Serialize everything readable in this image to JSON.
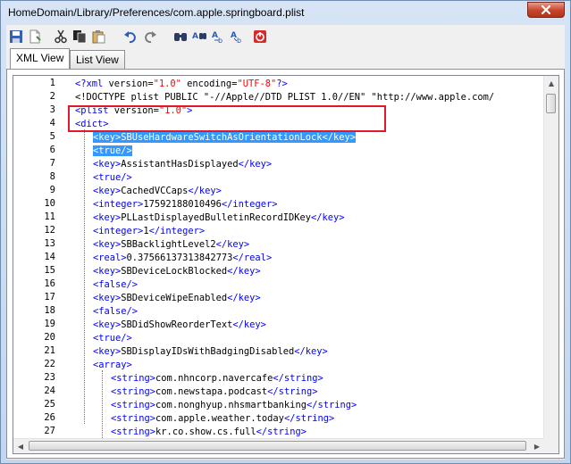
{
  "window": {
    "title": "HomeDomain/Library/Preferences/com.apple.springboard.plist"
  },
  "toolbar": {
    "buttons": [
      "save-icon",
      "new-icon",
      "cut-icon",
      "copy-icon",
      "paste-icon",
      "undo-icon",
      "redo-icon",
      "find-icon",
      "find-replace-icon",
      "find-next-icon",
      "replace-icon",
      "stop-icon"
    ]
  },
  "tabs": [
    {
      "label": "XML View",
      "active": true
    },
    {
      "label": "List View",
      "active": false
    }
  ],
  "line_numbers": [
    "1",
    "2",
    "3",
    "4",
    "5",
    "6",
    "7",
    "8",
    "9",
    "10",
    "11",
    "12",
    "13",
    "14",
    "15",
    "16",
    "17",
    "18",
    "19",
    "20",
    "21",
    "22",
    "23",
    "24",
    "25",
    "26",
    "27"
  ],
  "lines": [
    {
      "indent": 0,
      "segments": [
        [
          "tag",
          "<?xml "
        ],
        [
          "txt",
          "version="
        ],
        [
          "str",
          "\"1.0\""
        ],
        [
          "txt",
          " encoding="
        ],
        [
          "str",
          "\"UTF-8\""
        ],
        [
          "tag",
          "?>"
        ]
      ]
    },
    {
      "indent": 0,
      "segments": [
        [
          "txt",
          "<!DOCTYPE plist PUBLIC \"-//Apple//DTD PLIST 1.0//EN\" \"http://www.apple.com/"
        ]
      ]
    },
    {
      "indent": 0,
      "segments": [
        [
          "tag",
          "<plist "
        ],
        [
          "txt",
          "version="
        ],
        [
          "str",
          "\"1.0\""
        ],
        [
          "tag",
          ">"
        ]
      ]
    },
    {
      "indent": 0,
      "segments": [
        [
          "tag",
          "<dict>"
        ]
      ]
    },
    {
      "indent": 1,
      "selected": true,
      "segments": [
        [
          "sel",
          "<key>SBUseHardwareSwitchAsOrientationLock</key>"
        ]
      ]
    },
    {
      "indent": 1,
      "selected": true,
      "segments": [
        [
          "sel",
          "<true/>"
        ]
      ]
    },
    {
      "indent": 1,
      "segments": [
        [
          "tag",
          "<key>"
        ],
        [
          "txt",
          "AssistantHasDisplayed"
        ],
        [
          "tag",
          "</key>"
        ]
      ]
    },
    {
      "indent": 1,
      "segments": [
        [
          "tag",
          "<true/>"
        ]
      ]
    },
    {
      "indent": 1,
      "segments": [
        [
          "tag",
          "<key>"
        ],
        [
          "txt",
          "CachedVCCaps"
        ],
        [
          "tag",
          "</key>"
        ]
      ]
    },
    {
      "indent": 1,
      "segments": [
        [
          "tag",
          "<integer>"
        ],
        [
          "txt",
          "17592188010496"
        ],
        [
          "tag",
          "</integer>"
        ]
      ]
    },
    {
      "indent": 1,
      "segments": [
        [
          "tag",
          "<key>"
        ],
        [
          "txt",
          "PLLastDisplayedBulletinRecordIDKey"
        ],
        [
          "tag",
          "</key>"
        ]
      ]
    },
    {
      "indent": 1,
      "segments": [
        [
          "tag",
          "<integer>"
        ],
        [
          "txt",
          "1"
        ],
        [
          "tag",
          "</integer>"
        ]
      ]
    },
    {
      "indent": 1,
      "segments": [
        [
          "tag",
          "<key>"
        ],
        [
          "txt",
          "SBBacklightLevel2"
        ],
        [
          "tag",
          "</key>"
        ]
      ]
    },
    {
      "indent": 1,
      "segments": [
        [
          "tag",
          "<real>"
        ],
        [
          "txt",
          "0.37566137313842773"
        ],
        [
          "tag",
          "</real>"
        ]
      ]
    },
    {
      "indent": 1,
      "segments": [
        [
          "tag",
          "<key>"
        ],
        [
          "txt",
          "SBDeviceLockBlocked"
        ],
        [
          "tag",
          "</key>"
        ]
      ]
    },
    {
      "indent": 1,
      "segments": [
        [
          "tag",
          "<false/>"
        ]
      ]
    },
    {
      "indent": 1,
      "segments": [
        [
          "tag",
          "<key>"
        ],
        [
          "txt",
          "SBDeviceWipeEnabled"
        ],
        [
          "tag",
          "</key>"
        ]
      ]
    },
    {
      "indent": 1,
      "segments": [
        [
          "tag",
          "<false/>"
        ]
      ]
    },
    {
      "indent": 1,
      "segments": [
        [
          "tag",
          "<key>"
        ],
        [
          "txt",
          "SBDidShowReorderText"
        ],
        [
          "tag",
          "</key>"
        ]
      ]
    },
    {
      "indent": 1,
      "segments": [
        [
          "tag",
          "<true/>"
        ]
      ]
    },
    {
      "indent": 1,
      "segments": [
        [
          "tag",
          "<key>"
        ],
        [
          "txt",
          "SBDisplayIDsWithBadgingDisabled"
        ],
        [
          "tag",
          "</key>"
        ]
      ]
    },
    {
      "indent": 1,
      "segments": [
        [
          "tag",
          "<array>"
        ]
      ]
    },
    {
      "indent": 2,
      "segments": [
        [
          "tag",
          "<string>"
        ],
        [
          "txt",
          "com.nhncorp.navercafe"
        ],
        [
          "tag",
          "</string>"
        ]
      ]
    },
    {
      "indent": 2,
      "segments": [
        [
          "tag",
          "<string>"
        ],
        [
          "txt",
          "com.newstapa.podcast"
        ],
        [
          "tag",
          "</string>"
        ]
      ]
    },
    {
      "indent": 2,
      "segments": [
        [
          "tag",
          "<string>"
        ],
        [
          "txt",
          "com.nonghyup.nhsmartbanking"
        ],
        [
          "tag",
          "</string>"
        ]
      ]
    },
    {
      "indent": 2,
      "segments": [
        [
          "tag",
          "<string>"
        ],
        [
          "txt",
          "com.apple.weather.today"
        ],
        [
          "tag",
          "</string>"
        ]
      ]
    },
    {
      "indent": 2,
      "segments": [
        [
          "tag",
          "<string>"
        ],
        [
          "txt",
          "kr.co.show.cs.full"
        ],
        [
          "tag",
          "</string>"
        ]
      ]
    }
  ],
  "colors": {
    "tag": "#0000ff",
    "string": "#ff0000",
    "selection": "#3399ff",
    "highlight_box": "#e0182c"
  }
}
